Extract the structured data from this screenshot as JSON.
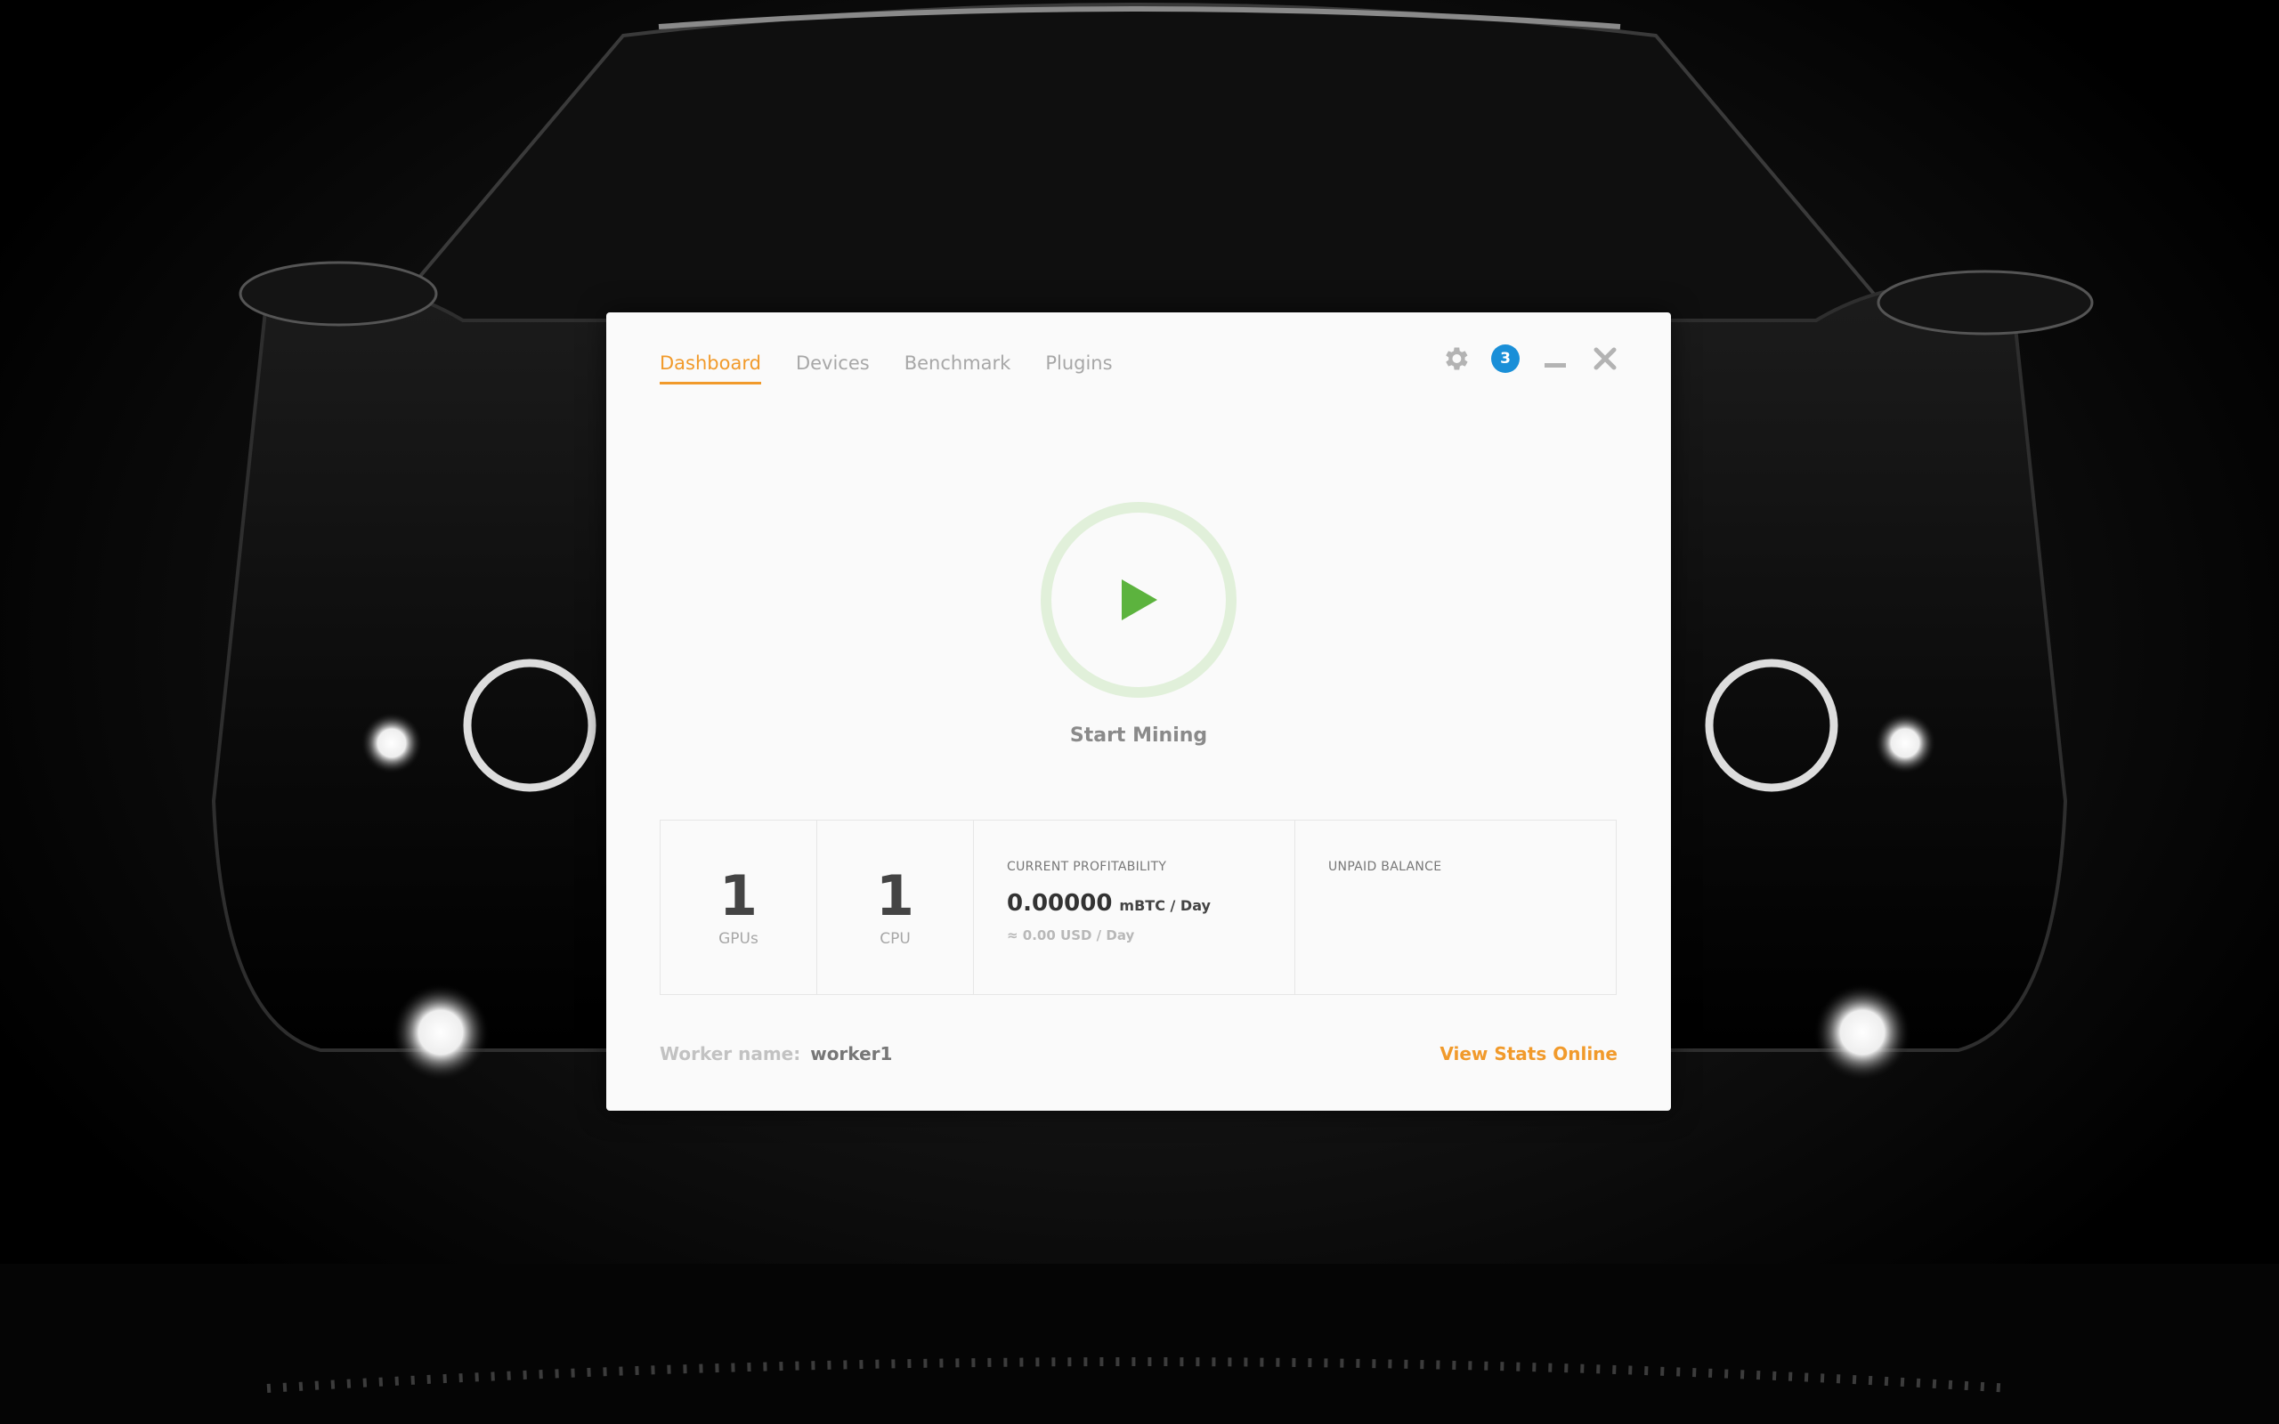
{
  "nav": {
    "tabs": [
      {
        "label": "Dashboard",
        "active": true
      },
      {
        "label": "Devices",
        "active": false
      },
      {
        "label": "Benchmark",
        "active": false
      },
      {
        "label": "Plugins",
        "active": false
      }
    ]
  },
  "controls": {
    "settings_icon": "gear-icon",
    "notifications_count": "3",
    "minimize_icon": "minimize-icon",
    "close_icon": "close-icon"
  },
  "start": {
    "icon": "play-icon",
    "label": "Start Mining"
  },
  "stats": {
    "gpus": {
      "value": "1",
      "label": "GPUs"
    },
    "cpus": {
      "value": "1",
      "label": "CPU"
    },
    "profitability": {
      "caption": "CURRENT PROFITABILITY",
      "value": "0.00000",
      "unit": "mBTC / Day",
      "usd": "≈ 0.00 USD / Day"
    },
    "balance": {
      "caption": "UNPAID BALANCE"
    }
  },
  "footer": {
    "worker_label": "Worker name:",
    "worker_value": "worker1",
    "view_stats": "View Stats Online"
  },
  "colors": {
    "accent": "#f19a2b",
    "play": "#5cb33e",
    "ring": "#e1f0da",
    "badge": "#1a8fd8"
  }
}
